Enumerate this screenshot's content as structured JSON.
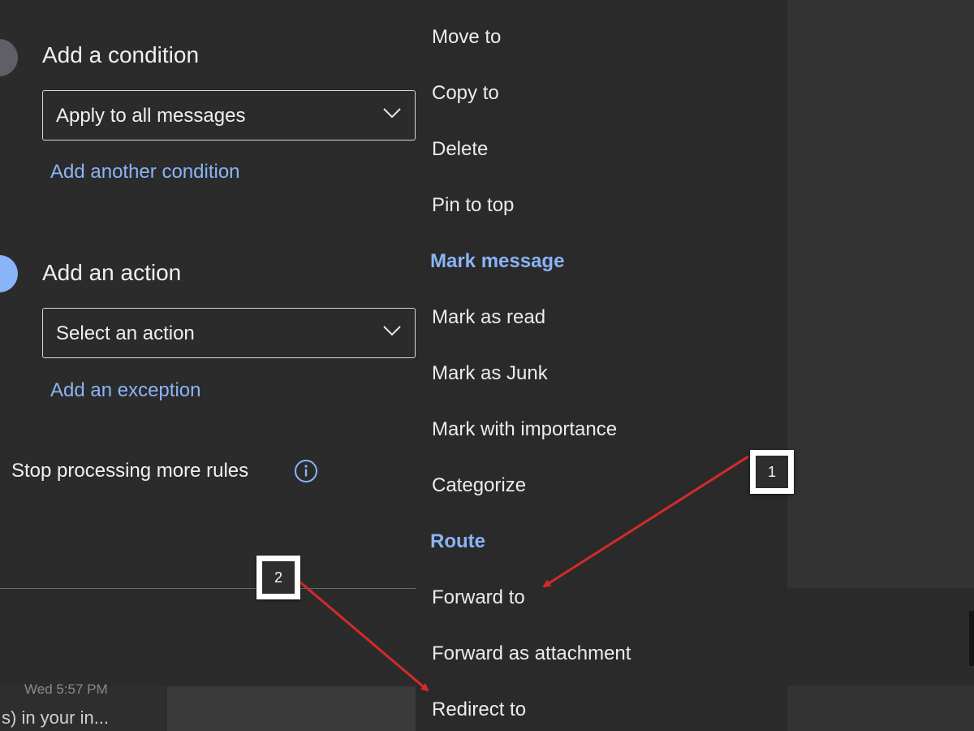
{
  "rule_editor": {
    "condition": {
      "title": "Add a condition",
      "select_value": "Apply to all messages",
      "add_link": "Add another condition"
    },
    "action": {
      "title": "Add an action",
      "select_value": "Select an action",
      "exception_link": "Add an exception"
    },
    "stop_processing_label": "Stop processing more rules"
  },
  "inbox_preview": {
    "date": "Wed 5:57 PM",
    "text": "s) in your in..."
  },
  "action_menu": {
    "items": [
      {
        "label": "Move to",
        "type": "item"
      },
      {
        "label": "Copy to",
        "type": "item"
      },
      {
        "label": "Delete",
        "type": "item"
      },
      {
        "label": "Pin to top",
        "type": "item"
      },
      {
        "label": "Mark message",
        "type": "header"
      },
      {
        "label": "Mark as read",
        "type": "item"
      },
      {
        "label": "Mark as Junk",
        "type": "item"
      },
      {
        "label": "Mark with importance",
        "type": "item"
      },
      {
        "label": "Categorize",
        "type": "item"
      },
      {
        "label": "Route",
        "type": "header"
      },
      {
        "label": "Forward to",
        "type": "item"
      },
      {
        "label": "Forward as attachment",
        "type": "item"
      },
      {
        "label": "Redirect to",
        "type": "item"
      }
    ]
  },
  "annotations": {
    "callout_1": "1",
    "callout_2": "2",
    "arrow_color": "#d42a2a"
  },
  "colors": {
    "accent": "#8ab4f8",
    "background": "#2b2b2b",
    "menu_background": "#2a2a2a"
  }
}
